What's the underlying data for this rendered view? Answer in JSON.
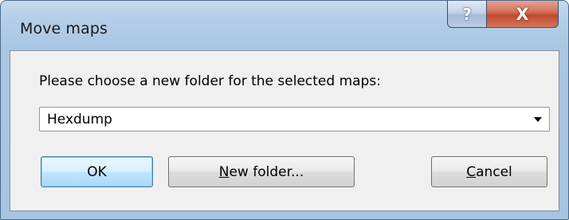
{
  "dialog": {
    "title": "Move maps",
    "caption_buttons": {
      "help_label": "?",
      "close_label": "X"
    },
    "prompt": "Please choose a new folder for the selected maps:",
    "folder_select": {
      "selected_value": "Hexdump",
      "arrow_icon": "dropdown-arrow-icon"
    },
    "buttons": {
      "ok_label": "OK",
      "new_folder_mnemonic": "N",
      "new_folder_rest": "ew folder...",
      "cancel_mnemonic": "C",
      "cancel_rest": "ancel"
    }
  },
  "colors": {
    "title_bar": "#b5cfe8",
    "client_area": "#f0f0f0",
    "close_button": "#c04a2c",
    "default_button_border": "#3c7fb1"
  }
}
